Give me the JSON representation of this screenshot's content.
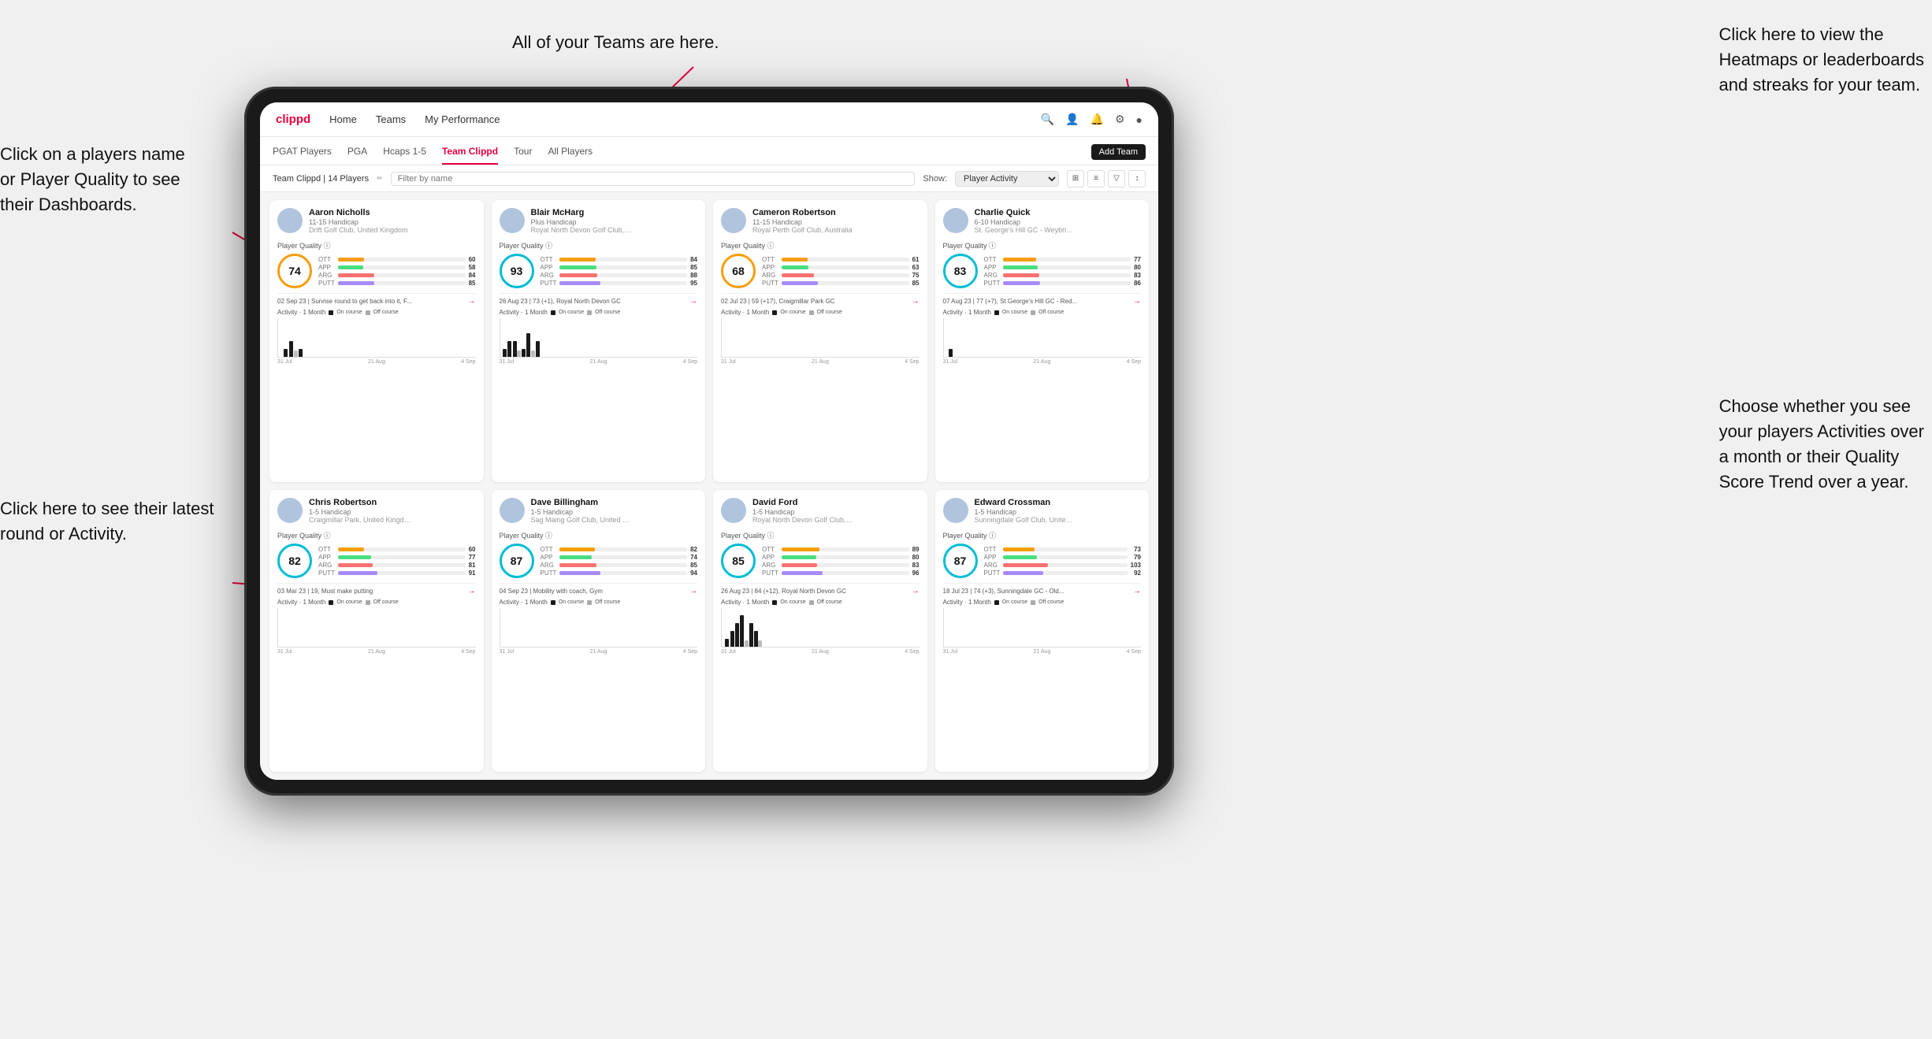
{
  "annotations": {
    "teams_callout": "All of your Teams are here.",
    "heatmaps_callout": "Click here to view the\nHeatmaps or leaderboards\nand streaks for your team.",
    "player_name_callout": "Click on a players name\nor Player Quality to see\ntheir Dashboards.",
    "round_callout": "Click here to see their latest\nround or Activity.",
    "activity_callout": "Choose whether you see\nyour players Activities over\na month or their Quality\nScore Trend over a year."
  },
  "navbar": {
    "brand": "clippd",
    "links": [
      "Home",
      "Teams",
      "My Performance"
    ],
    "add_team_label": "Add Team"
  },
  "subnav": {
    "tabs": [
      "PGAT Players",
      "PGA",
      "Hcaps 1-5",
      "Team Clippd",
      "Tour",
      "All Players"
    ],
    "active_tab": "Team Clippd"
  },
  "teambar": {
    "label": "Team Clippd | 14 Players",
    "search_placeholder": "Filter by name",
    "show_label": "Show:",
    "show_option": "Player Activity"
  },
  "players": [
    {
      "name": "Aaron Nicholls",
      "handicap": "11-15 Handicap",
      "club": "Drift Golf Club, United Kingdom",
      "quality": 74,
      "quality_level": "med",
      "stats": {
        "OTT": 60,
        "APP": 58,
        "ARG": 84,
        "PUTT": 85
      },
      "latest": "02 Sep 23 | Sunrise round to get back into it, F...",
      "activity_bars": [
        {
          "on": 0,
          "off": 0
        },
        {
          "on": 0,
          "off": 0
        },
        {
          "on": 0,
          "off": 0
        },
        {
          "on": 0,
          "off": 0
        },
        {
          "on": 0,
          "off": 0
        },
        {
          "on": 1,
          "off": 0
        },
        {
          "on": 0,
          "off": 0
        },
        {
          "on": 2,
          "off": 1
        },
        {
          "on": 1,
          "off": 0
        }
      ],
      "chart_labels": [
        "31 Jul",
        "21 Aug",
        "4 Sep"
      ]
    },
    {
      "name": "Blair McHarg",
      "handicap": "Plus Handicap",
      "club": "Royal North Devon Golf Club, United Kin...",
      "quality": 93,
      "quality_level": "high",
      "stats": {
        "OTT": 84,
        "APP": 85,
        "ARG": 88,
        "PUTT": 95
      },
      "latest": "26 Aug 23 | 73 (+1), Royal North Devon GC",
      "activity_bars": [
        {
          "on": 0,
          "off": 0
        },
        {
          "on": 1,
          "off": 0
        },
        {
          "on": 2,
          "off": 0
        },
        {
          "on": 0,
          "off": 0
        },
        {
          "on": 2,
          "off": 1
        },
        {
          "on": 1,
          "off": 0
        },
        {
          "on": 3,
          "off": 1
        },
        {
          "on": 2,
          "off": 0
        },
        {
          "on": 0,
          "off": 0
        }
      ],
      "chart_labels": [
        "31 Jul",
        "21 Aug",
        "4 Sep"
      ]
    },
    {
      "name": "Cameron Robertson",
      "handicap": "11-15 Handicap",
      "club": "Royal Perth Golf Club, Australia",
      "quality": 68,
      "quality_level": "med",
      "stats": {
        "OTT": 61,
        "APP": 63,
        "ARG": 75,
        "PUTT": 85
      },
      "latest": "02 Jul 23 | 59 (+17), Craigmillar Park GC",
      "activity_bars": [
        {
          "on": 0,
          "off": 0
        },
        {
          "on": 0,
          "off": 0
        },
        {
          "on": 0,
          "off": 0
        },
        {
          "on": 0,
          "off": 0
        },
        {
          "on": 0,
          "off": 0
        },
        {
          "on": 0,
          "off": 0
        },
        {
          "on": 0,
          "off": 0
        },
        {
          "on": 0,
          "off": 0
        },
        {
          "on": 0,
          "off": 0
        }
      ],
      "chart_labels": [
        "31 Jul",
        "21 Aug",
        "4 Sep"
      ]
    },
    {
      "name": "Charlie Quick",
      "handicap": "6-10 Handicap",
      "club": "St. George's Hill GC - Weybridge - Surrey...",
      "quality": 83,
      "quality_level": "high",
      "stats": {
        "OTT": 77,
        "APP": 80,
        "ARG": 83,
        "PUTT": 86
      },
      "latest": "07 Aug 23 | 77 (+7), St George's Hill GC - Red...",
      "activity_bars": [
        {
          "on": 0,
          "off": 0
        },
        {
          "on": 0,
          "off": 0
        },
        {
          "on": 0,
          "off": 0
        },
        {
          "on": 0,
          "off": 0
        },
        {
          "on": 1,
          "off": 0
        },
        {
          "on": 0,
          "off": 0
        },
        {
          "on": 0,
          "off": 0
        },
        {
          "on": 0,
          "off": 0
        },
        {
          "on": 0,
          "off": 0
        }
      ],
      "chart_labels": [
        "31 Jul",
        "21 Aug",
        "4 Sep"
      ]
    },
    {
      "name": "Chris Robertson",
      "handicap": "1-5 Handicap",
      "club": "Craigmillar Park, United Kingdom",
      "quality": 82,
      "quality_level": "high",
      "stats": {
        "OTT": 60,
        "APP": 77,
        "ARG": 81,
        "PUTT": 91
      },
      "latest": "03 Mar 23 | 19, Must make putting",
      "activity_bars": [
        {
          "on": 0,
          "off": 0
        },
        {
          "on": 0,
          "off": 0
        },
        {
          "on": 0,
          "off": 0
        },
        {
          "on": 0,
          "off": 0
        },
        {
          "on": 0,
          "off": 0
        },
        {
          "on": 0,
          "off": 0
        },
        {
          "on": 0,
          "off": 0
        },
        {
          "on": 0,
          "off": 0
        },
        {
          "on": 0,
          "off": 0
        }
      ],
      "chart_labels": [
        "31 Jul",
        "21 Aug",
        "4 Sep"
      ]
    },
    {
      "name": "Dave Billingham",
      "handicap": "1-5 Handicap",
      "club": "Sag Maing Golf Club, United Kingdom",
      "quality": 87,
      "quality_level": "high",
      "stats": {
        "OTT": 82,
        "APP": 74,
        "ARG": 85,
        "PUTT": 94
      },
      "latest": "04 Sep 23 | Mobility with coach, Gym",
      "activity_bars": [
        {
          "on": 0,
          "off": 0
        },
        {
          "on": 0,
          "off": 0
        },
        {
          "on": 0,
          "off": 0
        },
        {
          "on": 0,
          "off": 0
        },
        {
          "on": 0,
          "off": 0
        },
        {
          "on": 0,
          "off": 0
        },
        {
          "on": 0,
          "off": 0
        },
        {
          "on": 0,
          "off": 0
        },
        {
          "on": 0,
          "off": 0
        }
      ],
      "chart_labels": [
        "31 Jul",
        "21 Aug",
        "4 Sep"
      ]
    },
    {
      "name": "David Ford",
      "handicap": "1-5 Handicap",
      "club": "Royal North Devon Golf Club, United Kin...",
      "quality": 85,
      "quality_level": "high",
      "stats": {
        "OTT": 89,
        "APP": 80,
        "ARG": 83,
        "PUTT": 96
      },
      "latest": "26 Aug 23 | 84 (+12), Royal North Devon GC",
      "activity_bars": [
        {
          "on": 0,
          "off": 0
        },
        {
          "on": 0,
          "off": 0
        },
        {
          "on": 1,
          "off": 0
        },
        {
          "on": 0,
          "off": 0
        },
        {
          "on": 2,
          "off": 0
        },
        {
          "on": 3,
          "off": 0
        },
        {
          "on": 4,
          "off": 1
        },
        {
          "on": 3,
          "off": 0
        },
        {
          "on": 2,
          "off": 1
        }
      ],
      "chart_labels": [
        "31 Jul",
        "21 Aug",
        "4 Sep"
      ]
    },
    {
      "name": "Edward Crossman",
      "handicap": "1-5 Handicap",
      "club": "Sunningdale Golf Club, United Kingdom",
      "quality": 87,
      "quality_level": "high",
      "stats": {
        "OTT": 73,
        "APP": 79,
        "ARG": 103,
        "PUTT": 92
      },
      "latest": "18 Jul 23 | 74 (+3), Sunningdale GC - Old...",
      "activity_bars": [
        {
          "on": 0,
          "off": 0
        },
        {
          "on": 0,
          "off": 0
        },
        {
          "on": 0,
          "off": 0
        },
        {
          "on": 0,
          "off": 0
        },
        {
          "on": 0,
          "off": 0
        },
        {
          "on": 0,
          "off": 0
        },
        {
          "on": 0,
          "off": 0
        },
        {
          "on": 0,
          "off": 0
        },
        {
          "on": 0,
          "off": 0
        }
      ],
      "chart_labels": [
        "31 Jul",
        "21 Aug",
        "4 Sep"
      ]
    }
  ]
}
